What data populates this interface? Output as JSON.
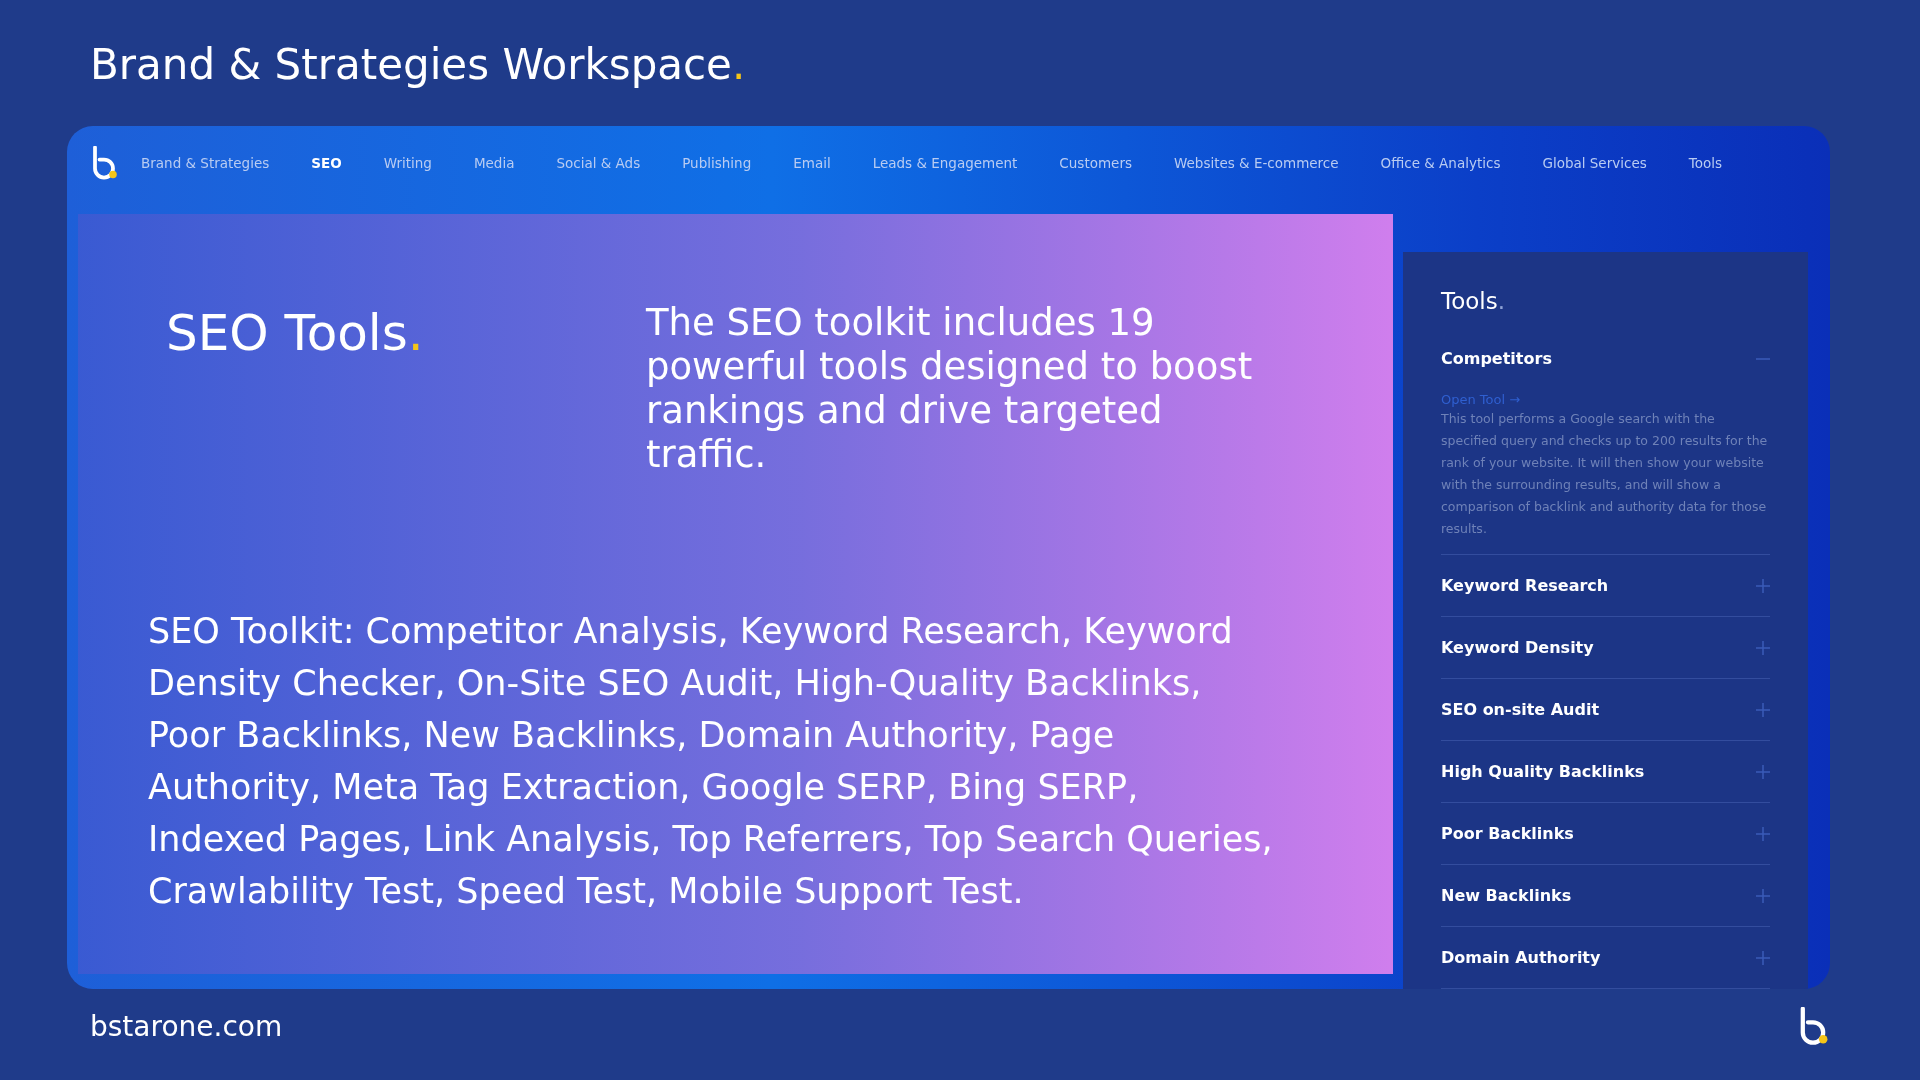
{
  "slide": {
    "title": "Brand & Strategies Workspace.",
    "footer": "bstarone.com"
  },
  "nav": {
    "tabs": [
      {
        "label": "Brand & Strategies",
        "selected": false
      },
      {
        "label": "SEO",
        "selected": true
      },
      {
        "label": "Writing",
        "selected": false
      },
      {
        "label": "Media",
        "selected": false
      },
      {
        "label": "Social & Ads",
        "selected": false
      },
      {
        "label": "Publishing",
        "selected": false
      },
      {
        "label": "Email",
        "selected": false
      },
      {
        "label": "Leads & Engagement",
        "selected": false
      },
      {
        "label": "Customers",
        "selected": false
      },
      {
        "label": "Websites & E-commerce",
        "selected": false
      },
      {
        "label": "Office & Analytics",
        "selected": false
      },
      {
        "label": "Global Services",
        "selected": false
      },
      {
        "label": "Tools",
        "selected": false
      }
    ]
  },
  "overlay": {
    "heading": "SEO Tools.",
    "intro": "The SEO toolkit includes 19 powerful tools designed to boost rankings and drive targeted traffic.",
    "summary": "SEO Toolkit: Competitor Analysis, Keyword Research, Keyword Density Checker, On-Site SEO Audit, High-Quality Backlinks, Poor Backlinks, New Backlinks, Domain Authority, Page Authority, Meta Tag Extraction, Google SERP, Bing SERP, Indexed Pages, Link Analysis, Top Referrers, Top Search Queries, Crawlability Test, Speed Test, Mobile Support Test."
  },
  "tools_panel": {
    "title": "Tools.",
    "items": [
      {
        "name": "Competitors",
        "expanded": true,
        "link": "Open Tool →",
        "description": "This tool performs a Google search with the specified query and checks up to 200 results for the rank of your website. It will then show your website with the surrounding results, and will show a comparison of backlink and authority data for those results."
      },
      {
        "name": "Keyword Research",
        "expanded": false
      },
      {
        "name": "Keyword Density",
        "expanded": false
      },
      {
        "name": "SEO on-site Audit",
        "expanded": false
      },
      {
        "name": "High Quality Backlinks",
        "expanded": false
      },
      {
        "name": "Poor Backlinks",
        "expanded": false
      },
      {
        "name": "New Backlinks",
        "expanded": false
      },
      {
        "name": "Domain Authority",
        "expanded": false
      }
    ]
  }
}
